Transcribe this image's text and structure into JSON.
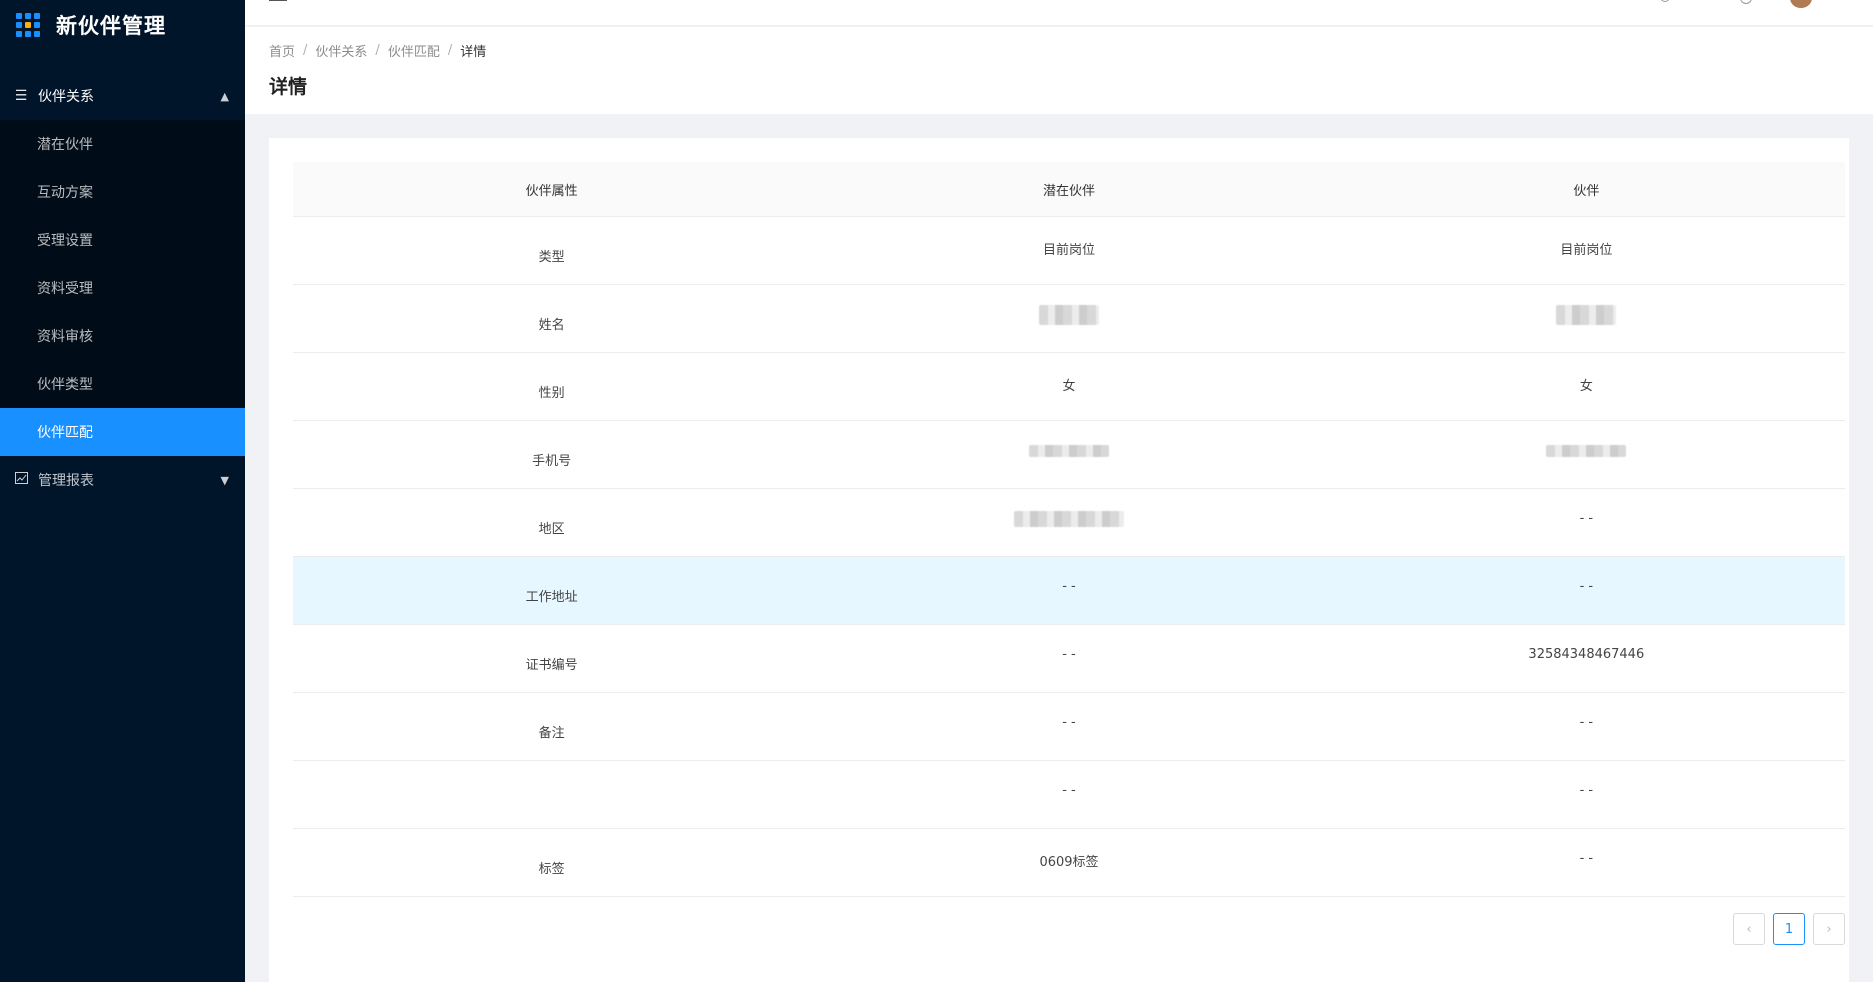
{
  "app": {
    "title": "新伙伴管理"
  },
  "colors": {
    "sidebar": "#001529",
    "accent": "#1890ff",
    "highlight_row": "#e6f7ff"
  },
  "sidebar": {
    "groups": [
      {
        "label": "伙伴关系",
        "icon": "menu-lines-icon",
        "expanded": true,
        "items": [
          "潜在伙伴",
          "互动方案",
          "受理设置",
          "资料受理",
          "资料审核",
          "伙伴类型",
          "伙伴匹配"
        ],
        "active": "伙伴匹配"
      },
      {
        "label": "管理报表",
        "icon": "chart-icon",
        "expanded": false
      }
    ]
  },
  "breadcrumb": [
    "首页",
    "伙伴关系",
    "伙伴匹配",
    "详情"
  ],
  "page_title": "详情",
  "table": {
    "headers": [
      "伙伴属性",
      "潜在伙伴",
      "伙伴"
    ],
    "rows": [
      {
        "attr": "类型",
        "potential": "目前岗位",
        "partner": "目前岗位"
      },
      {
        "attr": "姓名",
        "potential": "",
        "partner": ""
      },
      {
        "attr": "性别",
        "potential": "女",
        "partner": "女"
      },
      {
        "attr": "手机号",
        "potential": "",
        "partner": ""
      },
      {
        "attr": "地区",
        "potential": "",
        "partner": "- -"
      },
      {
        "attr": "工作地址",
        "potential": "- -",
        "partner": "- -"
      },
      {
        "attr": "证书编号",
        "potential": "- -",
        "partner": "32584348467446"
      },
      {
        "attr": "备注",
        "potential": "- -",
        "partner": "- -"
      },
      {
        "attr": "",
        "potential": "- -",
        "partner": "- -"
      },
      {
        "attr": "标签",
        "potential": "0609标签",
        "partner": "- -"
      }
    ]
  },
  "pagination": {
    "prev": "‹",
    "current": "1",
    "next": "›"
  }
}
